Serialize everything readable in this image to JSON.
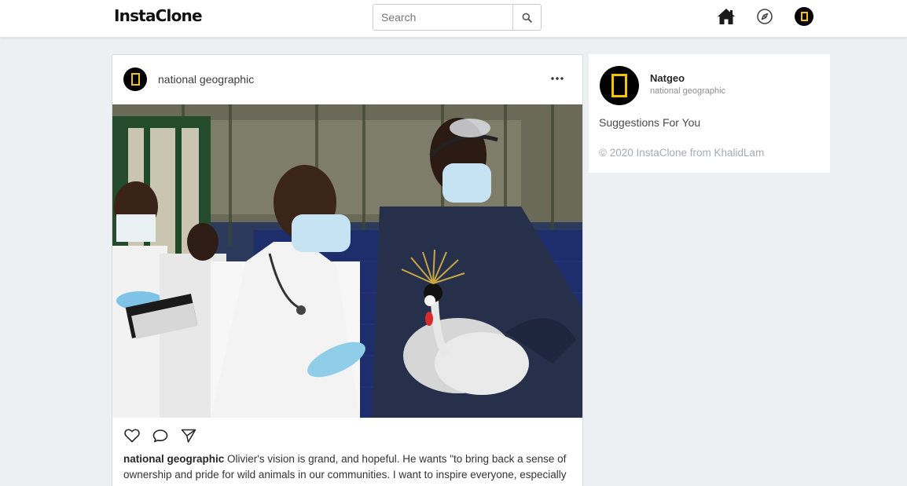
{
  "app": {
    "logo": "InstaClone"
  },
  "header": {
    "search_placeholder": "Search",
    "icons": [
      "search-icon",
      "home-icon",
      "compass-icon",
      "profile-avatar"
    ]
  },
  "post": {
    "username": "national geographic",
    "image_description_icon": "photo",
    "actions": [
      "heart-icon",
      "comment-icon",
      "share-icon"
    ],
    "caption_user": "national geographic",
    "caption_text": "Olivier's vision is grand, and hopeful. He wants \"to bring back a sense of ownership and pride for wild animals in our communities. I want to inspire everyone, especially"
  },
  "sidebar": {
    "profile_name": "Natgeo",
    "profile_subtitle": "national geographic",
    "suggestions_label": "Suggestions For You",
    "footer": "© 2020 InstaClone from KhalidLam"
  },
  "colors": {
    "background": "#edf0f3",
    "natgeo_yellow": "#f5c400",
    "avatar_bg": "#000000"
  }
}
